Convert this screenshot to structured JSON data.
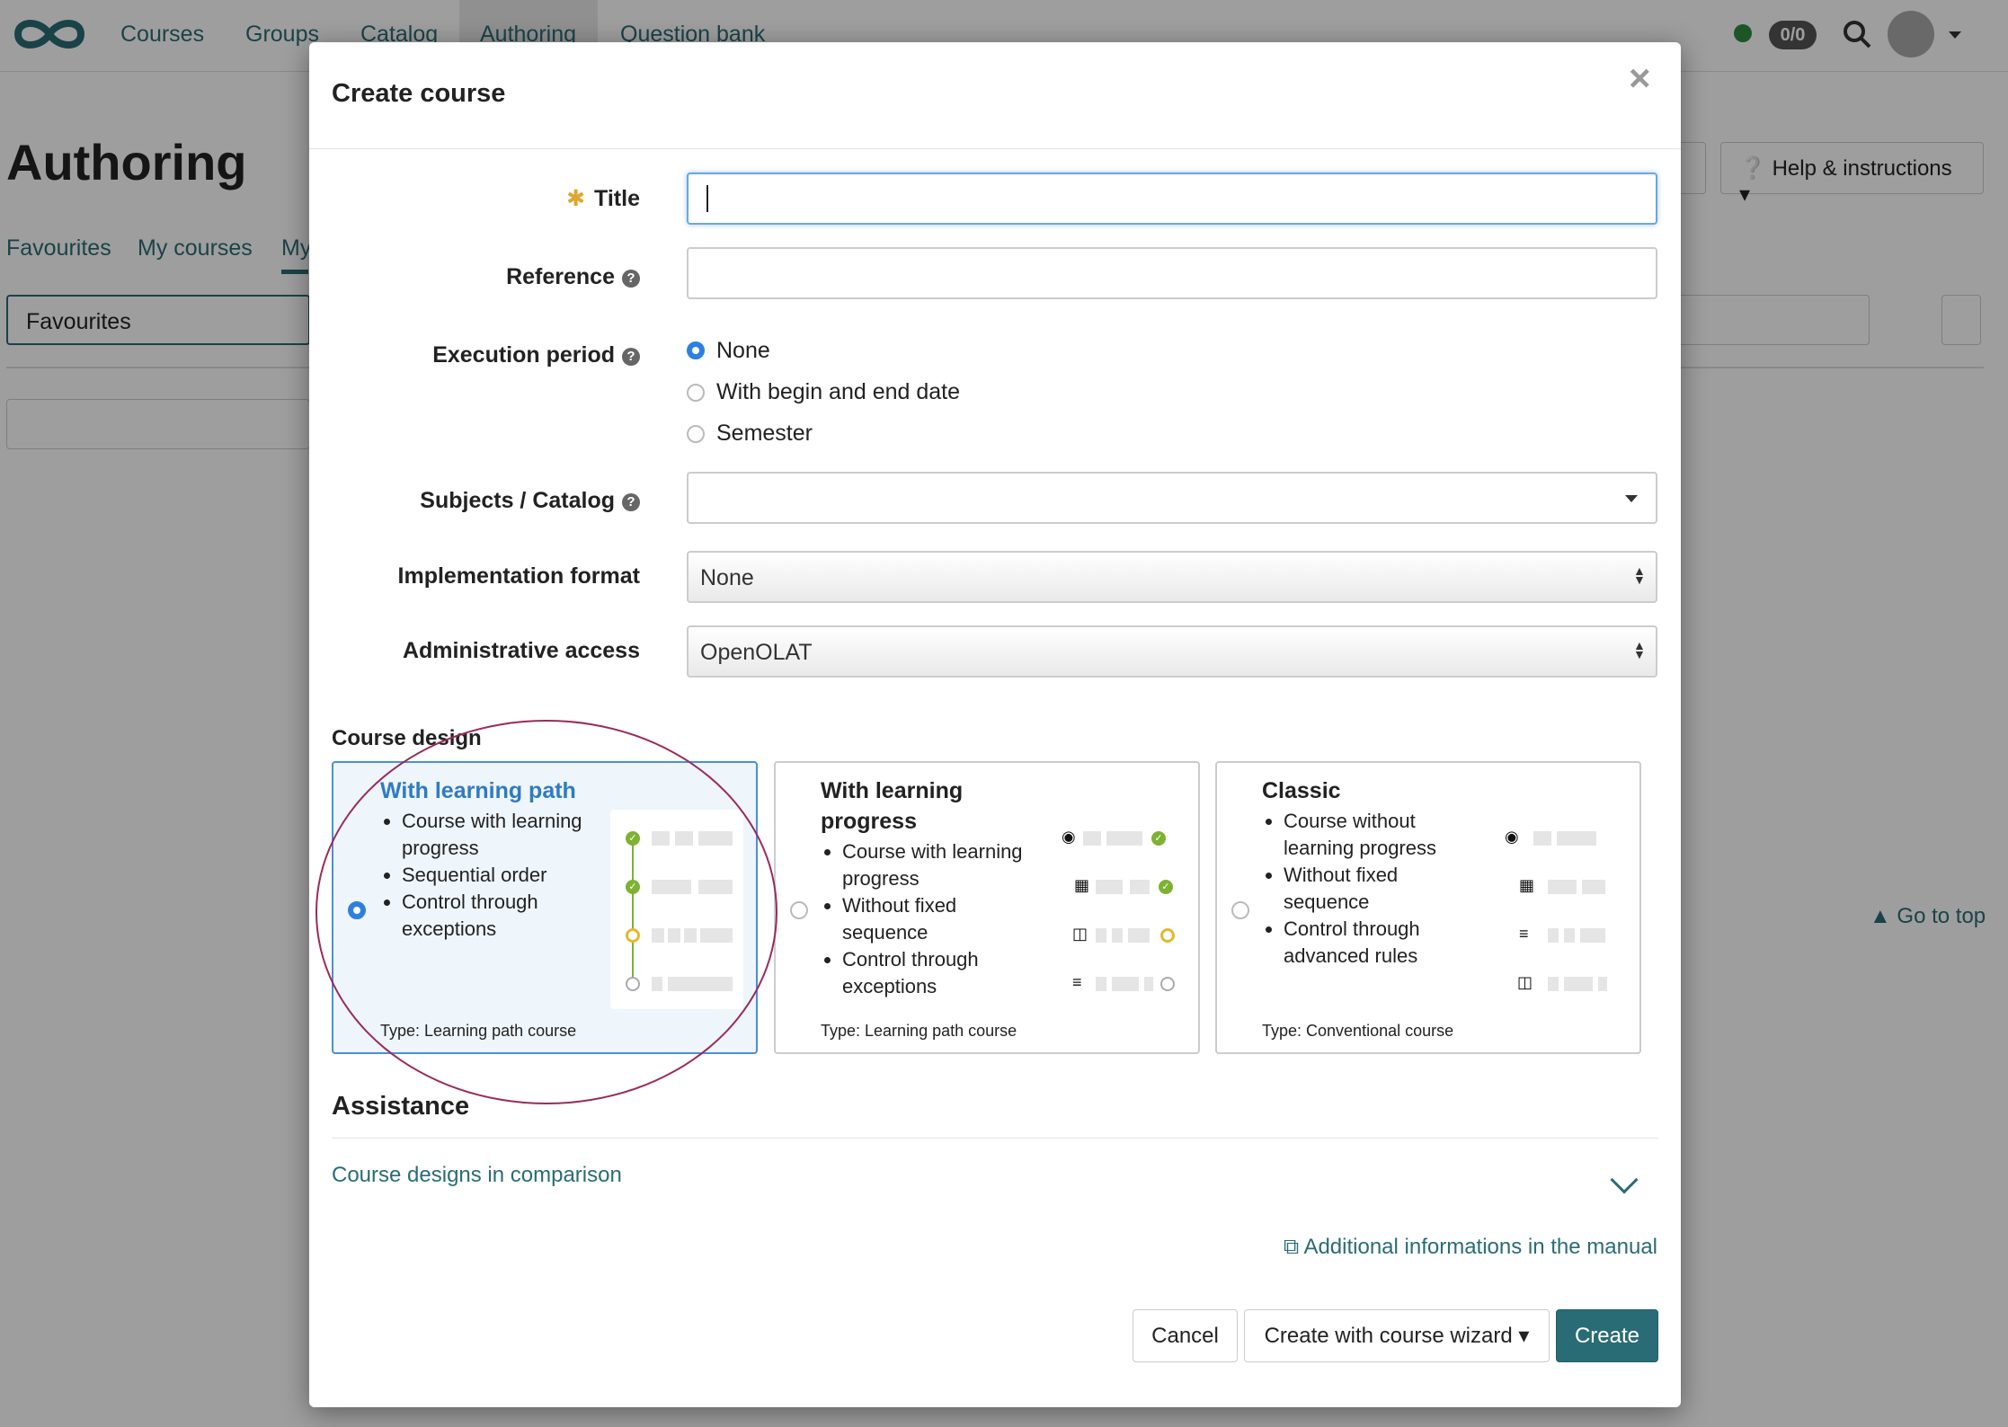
{
  "topnav": {
    "items": [
      "Courses",
      "Groups",
      "Catalog",
      "Authoring",
      "Question bank"
    ],
    "badge": "0/0",
    "icons": [
      "logo-infinity-icon",
      "search-icon",
      "avatar",
      "chevron-down-icon"
    ],
    "status_color": "#2e8b3e"
  },
  "page": {
    "title": "Authoring",
    "tabs": [
      "Favourites",
      "My courses",
      "My"
    ],
    "filter_value": "Favourites",
    "help_label": "Help & instructions",
    "goto_top": "Go to top"
  },
  "modal": {
    "title": "Create course",
    "fields": {
      "title_label": "Title",
      "title_value": "",
      "reference_label": "Reference",
      "reference_value": "",
      "execution_label": "Execution period",
      "execution_options": [
        "None",
        "With begin and end date",
        "Semester"
      ],
      "execution_selected": "None",
      "subjects_label": "Subjects / Catalog",
      "subjects_value": "",
      "implementation_label": "Implementation format",
      "implementation_value": "None",
      "admin_label": "Administrative access",
      "admin_value": "OpenOLAT"
    },
    "design": {
      "heading": "Course design",
      "selected": "With learning path",
      "cards": [
        {
          "title": "With learning path",
          "bullets": [
            "Course with learning progress",
            "Sequential order",
            "Control through exceptions"
          ],
          "type": "Type: Learning path course"
        },
        {
          "title": "With learning progress",
          "bullets": [
            "Course with learning progress",
            "Without fixed sequence",
            "Control through exceptions"
          ],
          "type": "Type: Learning path course"
        },
        {
          "title": "Classic",
          "bullets": [
            "Course without learning progress",
            "Without fixed sequence",
            "Control through advanced rules"
          ],
          "type": "Type: Conventional course"
        }
      ]
    },
    "assistance": {
      "heading": "Assistance",
      "compare_link": "Course designs in comparison",
      "manual_link": "Additional informations in the manual"
    },
    "buttons": {
      "cancel": "Cancel",
      "wizard": "Create with course wizard",
      "create": "Create"
    }
  },
  "colors": {
    "brand": "#2a6c75",
    "selected_card": "#eef5fb",
    "selected_border": "#4a90d6",
    "required": "#e0a532",
    "highlight_circle": "#9a2b5a"
  }
}
